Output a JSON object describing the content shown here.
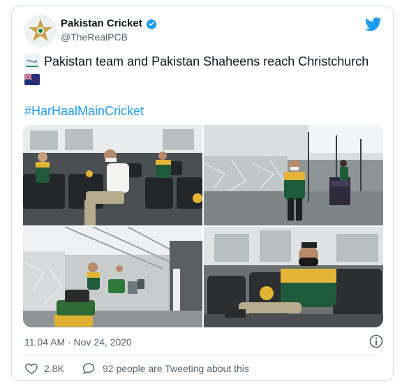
{
  "account": {
    "display_name": "Pakistan Cricket",
    "handle": "@TheRealPCB",
    "verified": true,
    "avatar_icon": "pcb-star-logo"
  },
  "tweet": {
    "text": "Pakistan team and Pakistan Shaheens reach Christchurch",
    "leading_emoji": "airplane-arrival-emoji",
    "trailing_emoji": "new-zealand-flag-emoji",
    "hashtag": "#HarHaalMainCricket",
    "timestamp": "11:04 AM · Nov 24, 2020"
  },
  "media": {
    "photo_count": 4,
    "descriptions": [
      "players-seated-in-airport-lounge",
      "player-with-luggage-trolley",
      "players-walking-with-luggage",
      "player-seated-in-lounge-chair"
    ]
  },
  "engagement": {
    "likes": "2.8K",
    "conversation": "92 people are Tweeting about this"
  },
  "colors": {
    "link_blue": "#1d9bf0",
    "twitter_blue": "#1d9bf0",
    "secondary_text": "#536471",
    "pcb_green": "#0a7a3a",
    "pcb_gold": "#c9a34a"
  }
}
